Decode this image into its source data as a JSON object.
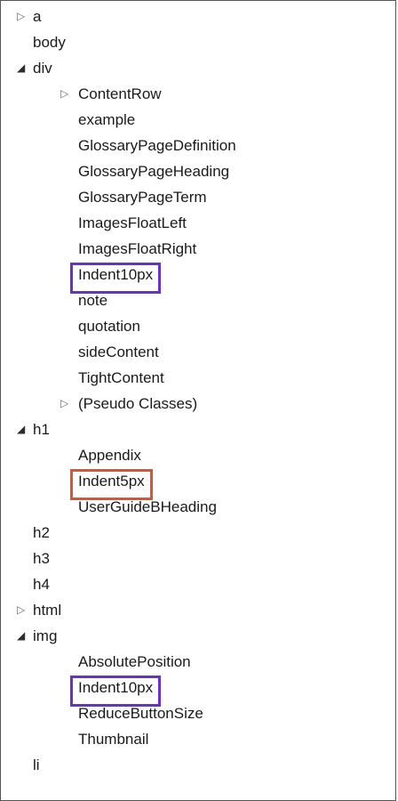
{
  "tree": [
    {
      "label": "a",
      "level": 0,
      "expander": "collapsed"
    },
    {
      "label": "body",
      "level": 0,
      "expander": "none"
    },
    {
      "label": "div",
      "level": 0,
      "expander": "expanded"
    },
    {
      "label": "ContentRow",
      "level": 1,
      "expander": "collapsed"
    },
    {
      "label": "example",
      "level": 1,
      "expander": "none"
    },
    {
      "label": "GlossaryPageDefinition",
      "level": 1,
      "expander": "none"
    },
    {
      "label": "GlossaryPageHeading",
      "level": 1,
      "expander": "none"
    },
    {
      "label": "GlossaryPageTerm",
      "level": 1,
      "expander": "none"
    },
    {
      "label": "ImagesFloatLeft",
      "level": 1,
      "expander": "none"
    },
    {
      "label": "ImagesFloatRight",
      "level": 1,
      "expander": "none"
    },
    {
      "label": "Indent10px",
      "level": 1,
      "expander": "none",
      "highlight": "purple"
    },
    {
      "label": "note",
      "level": 1,
      "expander": "none"
    },
    {
      "label": "quotation",
      "level": 1,
      "expander": "none"
    },
    {
      "label": "sideContent",
      "level": 1,
      "expander": "none"
    },
    {
      "label": "TightContent",
      "level": 1,
      "expander": "none"
    },
    {
      "label": "(Pseudo Classes)",
      "level": 1,
      "expander": "collapsed"
    },
    {
      "label": "h1",
      "level": 0,
      "expander": "expanded"
    },
    {
      "label": "Appendix",
      "level": 1,
      "expander": "none"
    },
    {
      "label": "Indent5px",
      "level": 1,
      "expander": "none",
      "highlight": "orange"
    },
    {
      "label": "UserGuideBHeading",
      "level": 1,
      "expander": "none"
    },
    {
      "label": "h2",
      "level": 0,
      "expander": "none"
    },
    {
      "label": "h3",
      "level": 0,
      "expander": "none"
    },
    {
      "label": "h4",
      "level": 0,
      "expander": "none"
    },
    {
      "label": "html",
      "level": 0,
      "expander": "collapsed"
    },
    {
      "label": "img",
      "level": 0,
      "expander": "expanded"
    },
    {
      "label": "AbsolutePosition",
      "level": 1,
      "expander": "none"
    },
    {
      "label": "Indent10px",
      "level": 1,
      "expander": "none",
      "highlight": "purple"
    },
    {
      "label": "ReduceButtonSize",
      "level": 1,
      "expander": "none"
    },
    {
      "label": "Thumbnail",
      "level": 1,
      "expander": "none"
    },
    {
      "label": "li",
      "level": 0,
      "expander": "none"
    }
  ],
  "colors": {
    "purple": "#6a2fcf",
    "orange": "#e2512a"
  }
}
